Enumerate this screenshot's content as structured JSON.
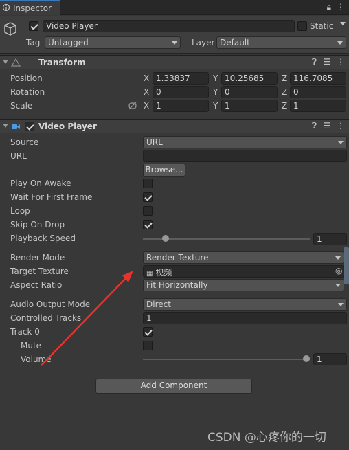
{
  "tab": {
    "title": "Inspector"
  },
  "gameobject": {
    "name": "Video Player",
    "static_label": "Static",
    "tag_label": "Tag",
    "tag_value": "Untagged",
    "layer_label": "Layer",
    "layer_value": "Default"
  },
  "transform": {
    "title": "Transform",
    "position": {
      "label": "Position",
      "x": "1.33837",
      "y": "10.25685",
      "z": "116.7085"
    },
    "rotation": {
      "label": "Rotation",
      "x": "0",
      "y": "0",
      "z": "0"
    },
    "scale": {
      "label": "Scale",
      "x": "1",
      "y": "1",
      "z": "1"
    },
    "axis_x": "X",
    "axis_y": "Y",
    "axis_z": "Z"
  },
  "video_player": {
    "title": "Video Player",
    "source_label": "Source",
    "source_value": "URL",
    "url_label": "URL",
    "url_value": "",
    "browse_label": "Browse...",
    "play_on_awake_label": "Play On Awake",
    "play_on_awake": false,
    "wait_first_frame_label": "Wait For First Frame",
    "wait_first_frame": true,
    "loop_label": "Loop",
    "loop": false,
    "skip_on_drop_label": "Skip On Drop",
    "skip_on_drop": true,
    "playback_speed_label": "Playback Speed",
    "playback_speed": "1",
    "playback_speed_fraction": 0.12,
    "render_mode_label": "Render Mode",
    "render_mode_value": "Render Texture",
    "target_texture_label": "Target Texture",
    "target_texture_value": "视频",
    "aspect_ratio_label": "Aspect Ratio",
    "aspect_ratio_value": "Fit Horizontally",
    "audio_output_label": "Audio Output Mode",
    "audio_output_value": "Direct",
    "controlled_tracks_label": "Controlled Tracks",
    "controlled_tracks_value": "1",
    "track0_label": "Track 0",
    "track0": true,
    "mute_label": "Mute",
    "mute": false,
    "volume_label": "Volume",
    "volume": "1",
    "volume_fraction": 1.0
  },
  "add_component_label": "Add Component",
  "watermark": "CSDN @心疼你的一切",
  "colors": {
    "arrow": "#e8322c",
    "tab_accent": "#3a79bb"
  }
}
